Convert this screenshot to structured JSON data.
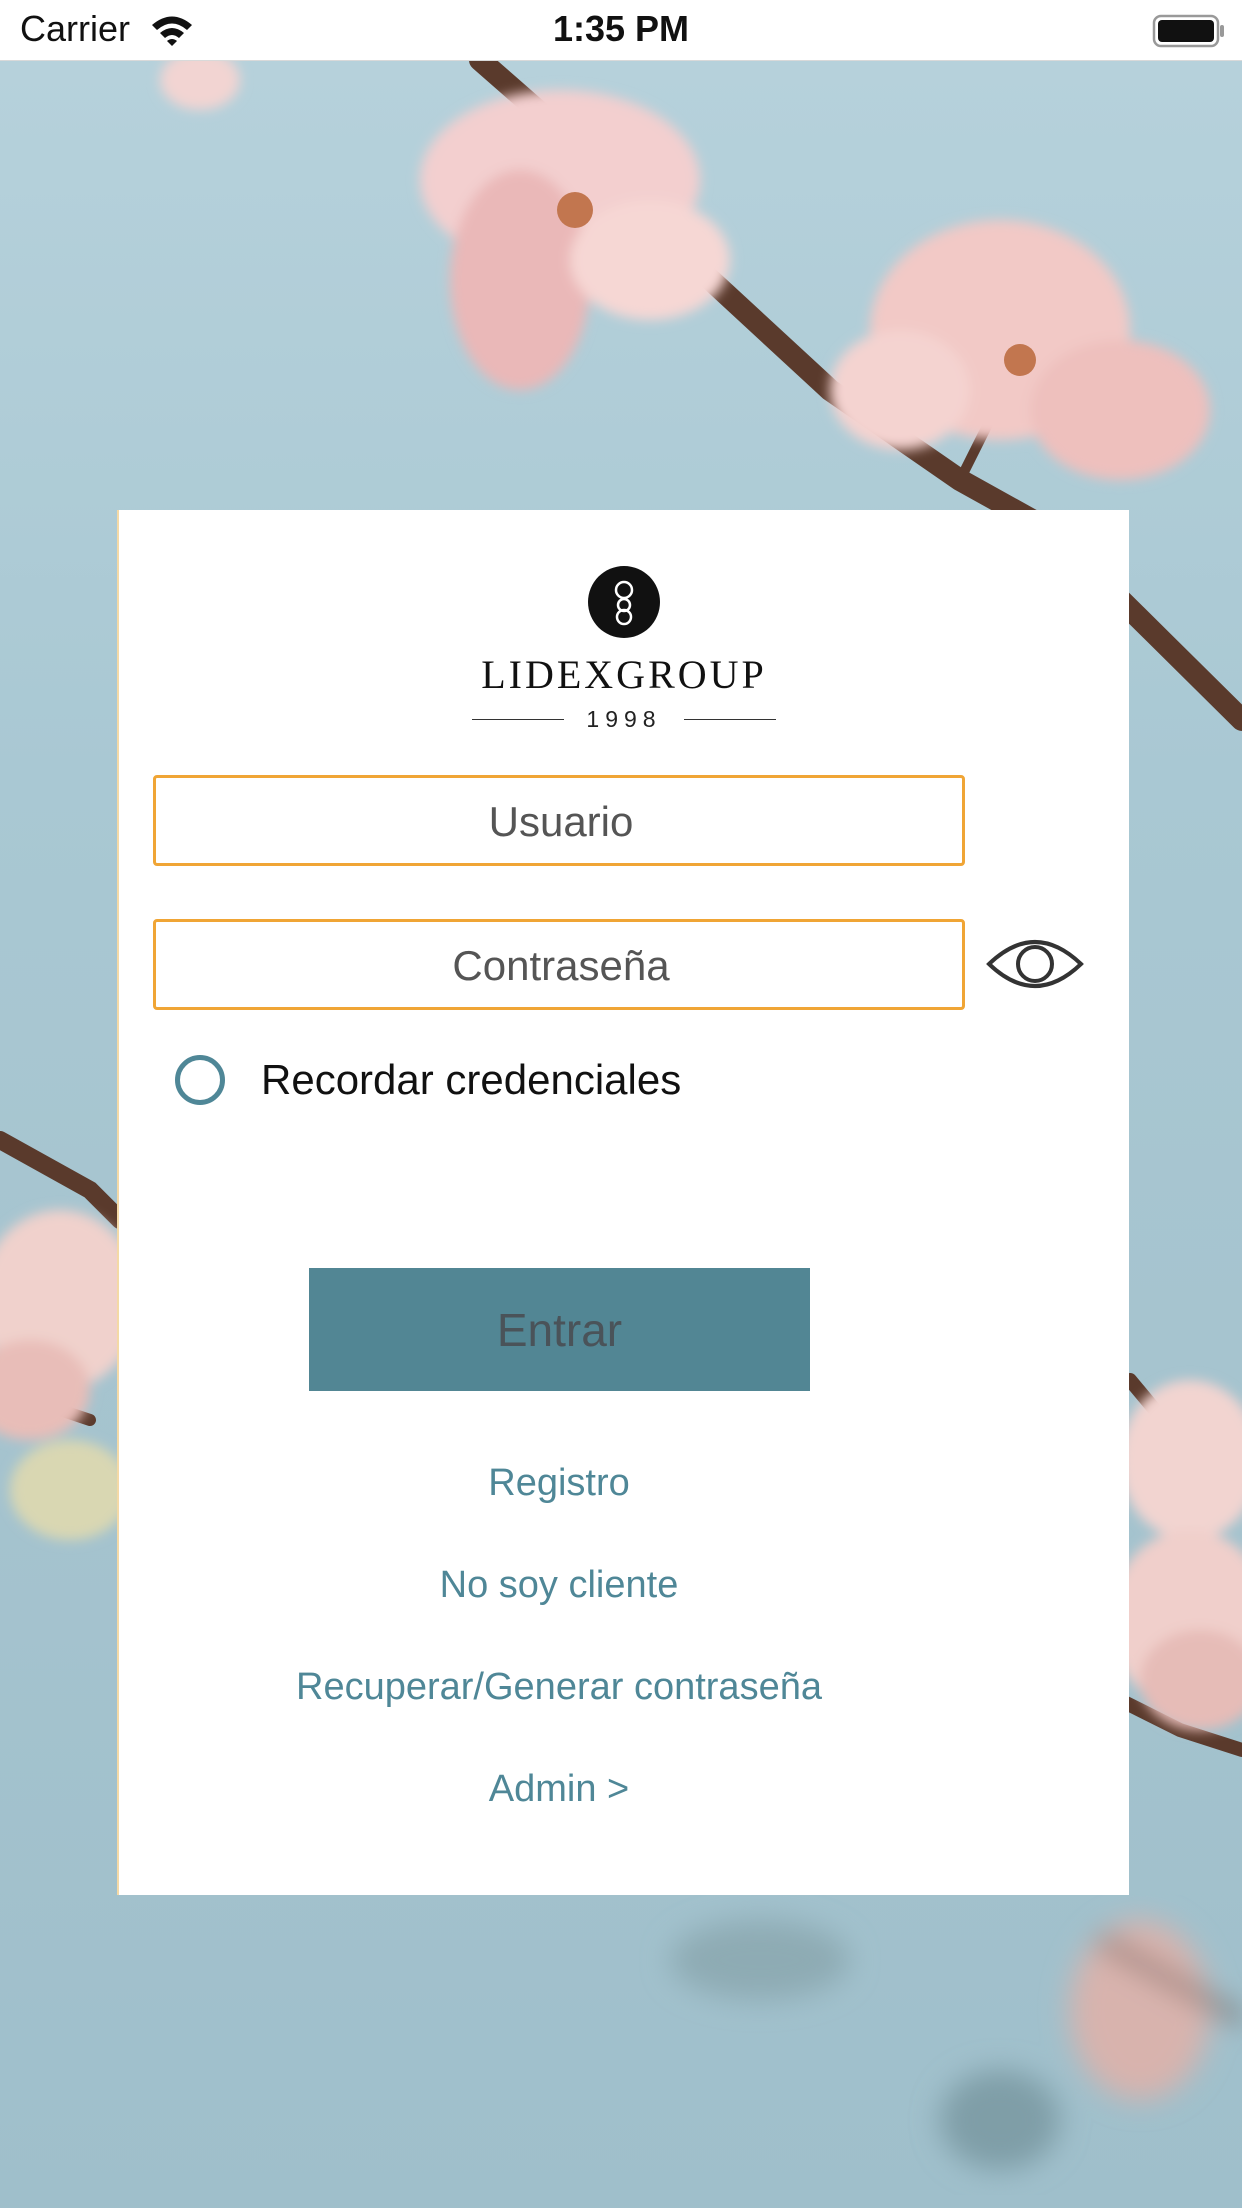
{
  "status_bar": {
    "carrier": "Carrier",
    "time": "1:35 PM",
    "wifi_icon": "wifi-icon",
    "battery_icon": "battery-full-icon"
  },
  "brand": {
    "logo_icon": "lidexgroup-monogram-icon",
    "name": "LIDEXGROUP",
    "year": "1998"
  },
  "login_form": {
    "username_placeholder": "Usuario",
    "username_value": "",
    "password_placeholder": "Contraseña",
    "password_value": "",
    "show_password_icon": "eye-icon",
    "remember_label": "Recordar credenciales",
    "remember_checked": false,
    "enter_label": "Entrar"
  },
  "links": {
    "register": "Registro",
    "not_client": "No soy cliente",
    "recover_password": "Recuperar/Generar contraseña",
    "admin": "Admin >"
  },
  "colors": {
    "field_border": "#f0a535",
    "accent": "#4f8797",
    "button_bg": "#528694",
    "background": "#a9c8d3"
  }
}
